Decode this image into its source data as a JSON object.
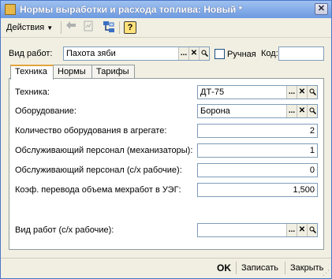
{
  "window": {
    "title": "Нормы выработки и расхода топлива: Новый *"
  },
  "toolbar": {
    "actions_label": "Действия",
    "help_label": "?"
  },
  "header": {
    "work_type_label": "Вид работ:",
    "work_type_value": "Пахота зяби",
    "manual_label": "Ручная",
    "code_label": "Код:",
    "code_value": ""
  },
  "tabs": [
    {
      "label": "Техника",
      "active": true
    },
    {
      "label": "Нормы",
      "active": false
    },
    {
      "label": "Тарифы",
      "active": false
    }
  ],
  "panel": {
    "equipment_label": "Техника:",
    "equipment_value": "ДТ-75",
    "attachment_label": "Оборудование:",
    "attachment_value": "Борона",
    "qty_label": "Количество оборудования в агрегате:",
    "qty_value": "2",
    "staff_mech_label": "Обслуживающий персонал (механизаторы):",
    "staff_mech_value": "1",
    "staff_agri_label": "Обслуживающий персонал (с/х рабочие):",
    "staff_agri_value": "0",
    "coef_label": "Коэф. перевода объема мехработ в УЭГ:",
    "coef_value": "1,500",
    "agri_work_type_label": "Вид работ (с/х рабочие):",
    "agri_work_type_value": ""
  },
  "footer": {
    "ok_label": "OK",
    "save_label": "Записать",
    "close_label": "Закрыть"
  },
  "icons": {
    "select": "...",
    "clear": "✕",
    "search": "🔍"
  }
}
